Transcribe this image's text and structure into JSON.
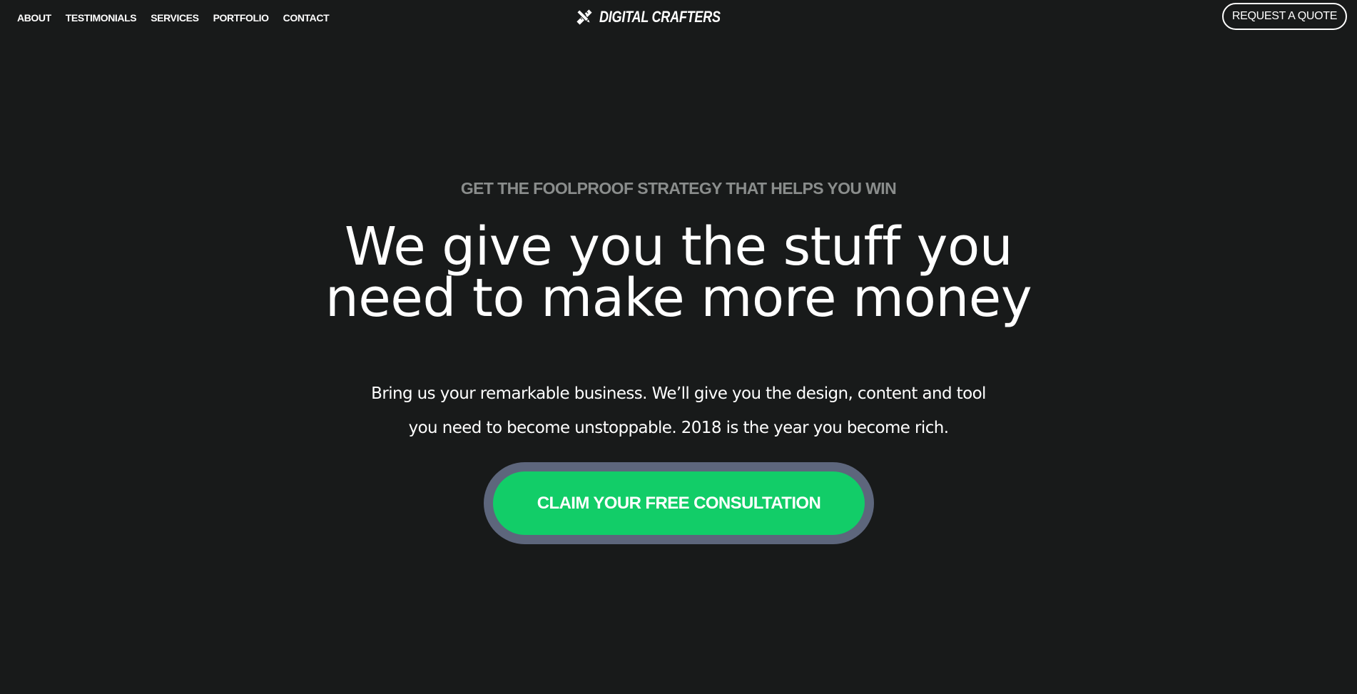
{
  "nav": {
    "items": [
      {
        "label": "ABOUT"
      },
      {
        "label": "TESTIMONIALS"
      },
      {
        "label": "SERVICES"
      },
      {
        "label": "PORTFOLIO"
      },
      {
        "label": "CONTACT"
      }
    ]
  },
  "brand": {
    "name": "DIGITAL CRAFTERS",
    "icon": "pencil-ruler-crossed-icon"
  },
  "header": {
    "cta_label": "REQUEST A QUOTE"
  },
  "hero": {
    "eyebrow": "GET THE FOOLPROOF STRATEGY THAT HELPS YOU WIN",
    "headline_lines": [
      "We give you the stuff you",
      "need to make more money"
    ],
    "subcopy_lines": [
      "Bring us your remarkable business. We’ll give you the design, content and tool",
      "you need to become unstoppable. 2018 is the year you become rich."
    ],
    "cta_label": "CLAIM YOUR FREE CONSULTATION"
  },
  "colors": {
    "background": "#181a1a",
    "text": "#ffffff",
    "eyebrow": "#8a8d8c",
    "cta_green": "#12cd68",
    "cta_ring": "#5d667c"
  }
}
